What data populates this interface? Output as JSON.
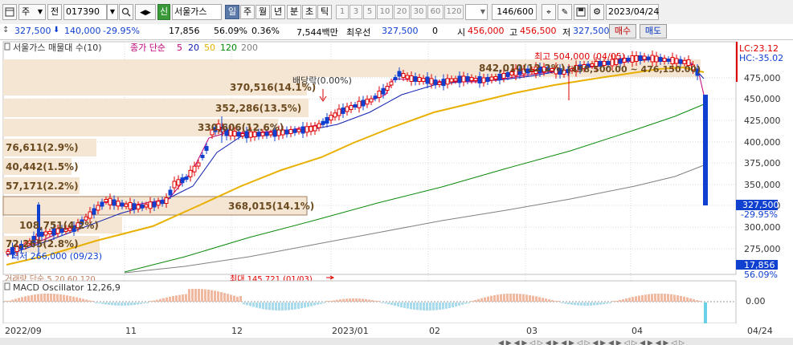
{
  "toolbar": {
    "period_mode": "주",
    "prev_label": "전",
    "code": "017390",
    "badge": "신",
    "stock_name": "서울가스",
    "tabs": [
      "일",
      "주",
      "월",
      "년",
      "분",
      "초",
      "틱"
    ],
    "active_tab": "일",
    "periods": [
      "1",
      "3",
      "5",
      "10",
      "20",
      "30",
      "60",
      "120"
    ],
    "count": "146/600",
    "date": "2023/04/24"
  },
  "quote": {
    "price": "327,500",
    "change": "140,000",
    "change_pct": "-29.95%",
    "volume": "17,856",
    "vol_pct": "56.09%",
    "turnover": "0.36%",
    "amount": "7,544백만",
    "best_label": "최우선",
    "best_price": "327,500",
    "best_qty": "0",
    "open_label": "시",
    "open": "456,000",
    "high_label": "고",
    "high": "456,500",
    "low_label": "저",
    "low": "327,500",
    "buy_label": "매수",
    "sell_label": "매도"
  },
  "legend": {
    "title": "서울가스 매물대 수(10)",
    "ma_label": "종가 단순",
    "ma_periods": [
      "5",
      "20",
      "50",
      "120",
      "200"
    ],
    "ma_colors": [
      "#c0007a",
      "#1020b0",
      "#e8b000",
      "#008a00",
      "#808080"
    ]
  },
  "right_top": {
    "lc": "LC:23.12",
    "hc": "HC:-35.02"
  },
  "price_axis": [
    "475,000",
    "450,000",
    "425,000",
    "400,000",
    "375,000",
    "350,000",
    "325,000",
    "300,000",
    "275,000"
  ],
  "current_price_box": "327,500",
  "current_pct": "-29.95%",
  "volume_box": "17,856",
  "volume_pct": "56.09%",
  "macd": {
    "title": "MACD Oscillator 12,26,9",
    "zero_label": "0.00",
    "volume_legend": "거래량 단순 5 20 60 120"
  },
  "volume_max_note": "최대 145,721 (01/03)",
  "date_axis": [
    "2022/09",
    "11",
    "12",
    "2023/01",
    "02",
    "03",
    "04",
    "04/24"
  ],
  "annotations": {
    "high": "최고 504,000 (04/05)",
    "low": "최저 266,000 (09/23)",
    "dividend": "배당락(0.00%)",
    "range": "(498,500.00 ~ 476,150.00)"
  },
  "profile": [
    {
      "label": "842,010(12.2%)"
    },
    {
      "label": "370,516(14.1%)"
    },
    {
      "label": "352,286(13.5%)"
    },
    {
      "label": "330,606(12.6%)"
    },
    {
      "label": "76,611(2.9%)"
    },
    {
      "label": "40,442(1.5%)"
    },
    {
      "label": "57,171(2.2%)"
    },
    {
      "label": "368,015(14.1%)"
    },
    {
      "label": "108,751(4.2%)"
    },
    {
      "label": "72,265(2.8%)"
    }
  ],
  "colors": {
    "up": "#e00000",
    "down": "#1040d0",
    "profile": "#f5e6d3",
    "accent": "#5a78a8"
  }
}
